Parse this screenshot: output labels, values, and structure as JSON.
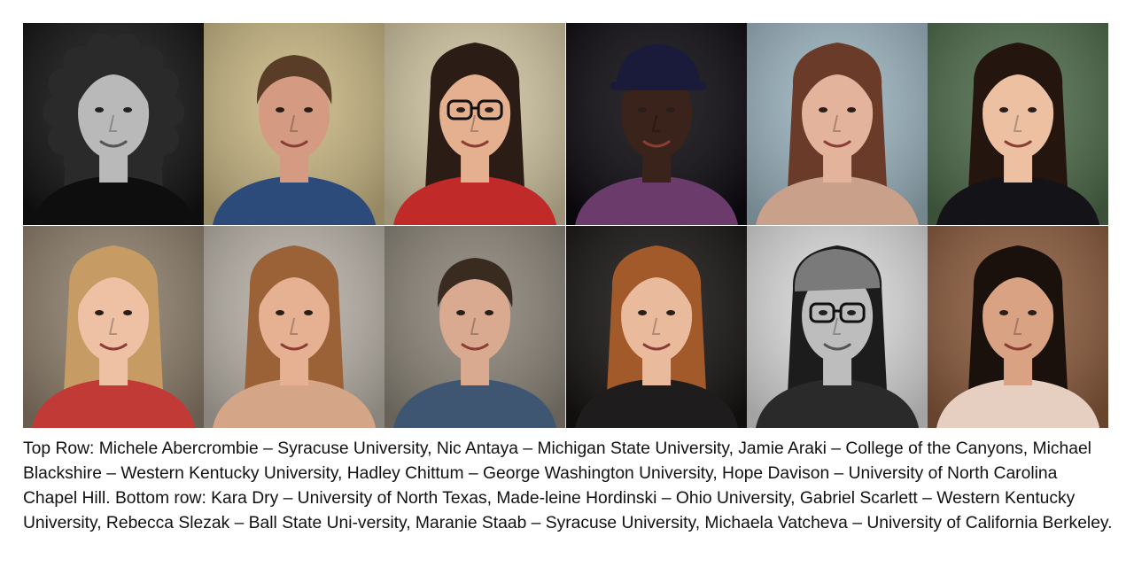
{
  "caption": "Top Row: Michele Abercrombie – Syracuse University, Nic Antaya – Michigan State University, Jamie Araki – College of the Canyons, Michael Blackshire – Western Kentucky University, Hadley Chittum – George Washington University, Hope Davison – University of North Carolina Chapel Hill. Bottom row: Kara Dry – University of North Texas, Made-leine Hordinski – Ohio University, Gabriel Scarlett – Western Kentucky University, Rebecca Slezak – Ball State Uni-versity, Maranie Staab – Syracuse University, Michaela Vatcheva – University of California Berkeley.",
  "portraits": [
    {
      "row": "top",
      "bg": "#121212",
      "skin": "#b9b9b9",
      "hair": "#2a2a2a",
      "shirt": "#0e0e0e",
      "style": "curly",
      "mono": true
    },
    {
      "row": "top",
      "bg": "#c7b582",
      "skin": "#d49b82",
      "hair": "#5a3d27",
      "shirt": "#2c4a7a",
      "style": "short",
      "mono": false
    },
    {
      "row": "top",
      "bg": "#cfc3a0",
      "skin": "#e5b08f",
      "hair": "#2b1c15",
      "shirt": "#c02a28",
      "style": "long-glasses",
      "mono": false
    },
    {
      "row": "top",
      "bg": "#0c0a10",
      "skin": "#3a231a",
      "hair": "#1a1b3a",
      "shirt": "#6a3b6b",
      "style": "cap",
      "mono": false
    },
    {
      "row": "top",
      "bg": "#9bb3be",
      "skin": "#e4b39b",
      "hair": "#6b3b2a",
      "shirt": "#c9a08a",
      "style": "long",
      "mono": false
    },
    {
      "row": "top",
      "bg": "#4d6a49",
      "skin": "#ecc0a1",
      "hair": "#24160f",
      "shirt": "#141418",
      "style": "long",
      "mono": false
    },
    {
      "row": "bottom",
      "bg": "#8c7d6a",
      "skin": "#eec1a4",
      "hair": "#c79b64",
      "shirt": "#c23a35",
      "style": "long",
      "mono": false
    },
    {
      "row": "bottom",
      "bg": "#b7b0a6",
      "skin": "#e6b193",
      "hair": "#9a6236",
      "shirt": "#d4a587",
      "style": "long",
      "mono": false
    },
    {
      "row": "bottom",
      "bg": "#8a8377",
      "skin": "#d9aa90",
      "hair": "#3a2b20",
      "shirt": "#3f5672",
      "style": "short",
      "mono": false
    },
    {
      "row": "bottom",
      "bg": "#171412",
      "skin": "#eaba9c",
      "hair": "#a25a2a",
      "shirt": "#1e1c1c",
      "style": "long",
      "mono": false
    },
    {
      "row": "bottom",
      "bg": "#d9d9d9",
      "skin": "#bdbdbd",
      "hair": "#1c1c1c",
      "shirt": "#2a2a2a",
      "style": "cap-glasses",
      "mono": true
    },
    {
      "row": "bottom",
      "bg": "#8a5a3c",
      "skin": "#d9a283",
      "hair": "#1a100c",
      "shirt": "#e6cfc0",
      "style": "long",
      "mono": false
    }
  ]
}
